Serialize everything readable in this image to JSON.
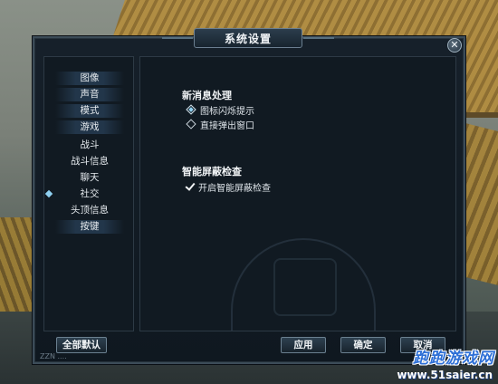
{
  "window": {
    "title": "系统设置",
    "close_glyph": "✕"
  },
  "sidebar": {
    "items": [
      {
        "label": "图像",
        "style": "tab"
      },
      {
        "label": "声音",
        "style": "tab"
      },
      {
        "label": "模式",
        "style": "tab"
      },
      {
        "label": "游戏",
        "style": "tab"
      },
      {
        "label": "战斗",
        "style": "plain"
      },
      {
        "label": "战斗信息",
        "style": "plain"
      },
      {
        "label": "聊天",
        "style": "plain"
      },
      {
        "label": "社交",
        "style": "plain",
        "selected": true
      },
      {
        "label": "头顶信息",
        "style": "plain"
      },
      {
        "label": "按键",
        "style": "tab"
      }
    ]
  },
  "settings": {
    "new_message": {
      "title": "新消息处理",
      "options": [
        {
          "label": "图标闪烁提示",
          "selected": true
        },
        {
          "label": "直接弹出窗口",
          "selected": false
        }
      ]
    },
    "smart_block": {
      "title": "智能屏蔽检查",
      "checkbox_label": "开启智能屏蔽检查",
      "checked": true
    }
  },
  "buttons": {
    "defaults": "全部默认",
    "apply": "应用",
    "confirm": "确定",
    "cancel": "取消"
  },
  "status": {
    "text": "ZZN ...."
  },
  "watermark": {
    "logo": "跑跑游戏网",
    "url": "www.51saier.cn"
  },
  "colors": {
    "accent": "#8fd0f0",
    "panel": "#111a22",
    "watermark": "#2d6fd6"
  }
}
